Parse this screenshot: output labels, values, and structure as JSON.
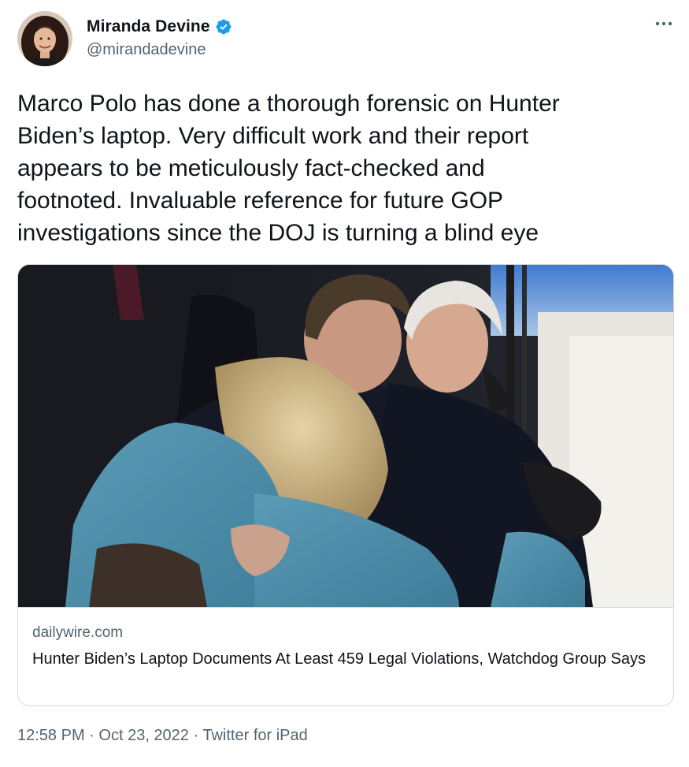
{
  "author": {
    "display_name": "Miranda Devine",
    "handle": "@mirandadevine",
    "verified": true,
    "avatar_icon": "profile-photo"
  },
  "tweet": {
    "text_lines": [
      "Marco Polo has done a thorough forensic on Hunter",
      "Biden’s laptop. Very difficult work and their report",
      "appears to be meticulously fact-checked and",
      "footnoted. Invaluable reference for future GOP",
      "investigations since the DOJ is turning a blind eye"
    ]
  },
  "link_card": {
    "domain": "dailywire.com",
    "title": "Hunter Biden’s Laptop Documents At Least 459 Legal Violations, Watchdog Group Says",
    "image": "photo of three people embracing"
  },
  "meta": {
    "time": "12:58 PM",
    "separator": "·",
    "date": "Oct 23, 2022",
    "source": "Twitter for iPad"
  },
  "colors": {
    "text_primary": "#0f1419",
    "text_secondary": "#536471",
    "verified_blue": "#1d9bf0",
    "border": "#cfd9de"
  },
  "icons": {
    "verified": "verified-badge-icon",
    "more": "more-options-icon"
  }
}
